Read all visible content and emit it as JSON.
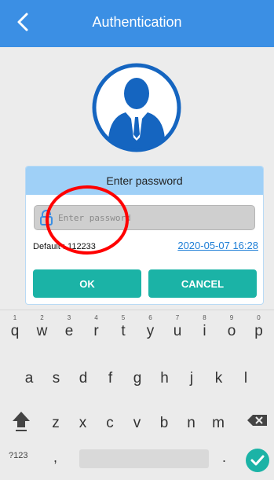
{
  "header": {
    "title": "Authentication"
  },
  "dialog": {
    "title": "Enter password",
    "password_placeholder": "Enter password",
    "default_text": "Default : 112233",
    "datetime": "2020-05-07 16:28",
    "ok_label": "OK",
    "cancel_label": "CANCEL"
  },
  "keyboard": {
    "row1": [
      {
        "char": "q",
        "hint": "1"
      },
      {
        "char": "w",
        "hint": "2"
      },
      {
        "char": "e",
        "hint": "3"
      },
      {
        "char": "r",
        "hint": "4"
      },
      {
        "char": "t",
        "hint": "5"
      },
      {
        "char": "y",
        "hint": "6"
      },
      {
        "char": "u",
        "hint": "7"
      },
      {
        "char": "i",
        "hint": "8"
      },
      {
        "char": "o",
        "hint": "9"
      },
      {
        "char": "p",
        "hint": "0"
      }
    ],
    "row2": [
      "a",
      "s",
      "d",
      "f",
      "g",
      "h",
      "j",
      "k",
      "l"
    ],
    "row3": [
      "z",
      "x",
      "c",
      "v",
      "b",
      "n",
      "m"
    ],
    "symbols_label": "?123",
    "comma": ",",
    "period": ".",
    "icons": {
      "shift": "shift-arrow-icon",
      "backspace": "backspace-icon",
      "done": "checkmark-circle-icon"
    }
  },
  "colors": {
    "header_bg": "#3b8fe4",
    "dialog_header_bg": "#9fd0f7",
    "button_bg": "#1bb3a6",
    "link": "#1e7ed6",
    "annotation": "#ff0000",
    "avatar": "#1565c0"
  }
}
